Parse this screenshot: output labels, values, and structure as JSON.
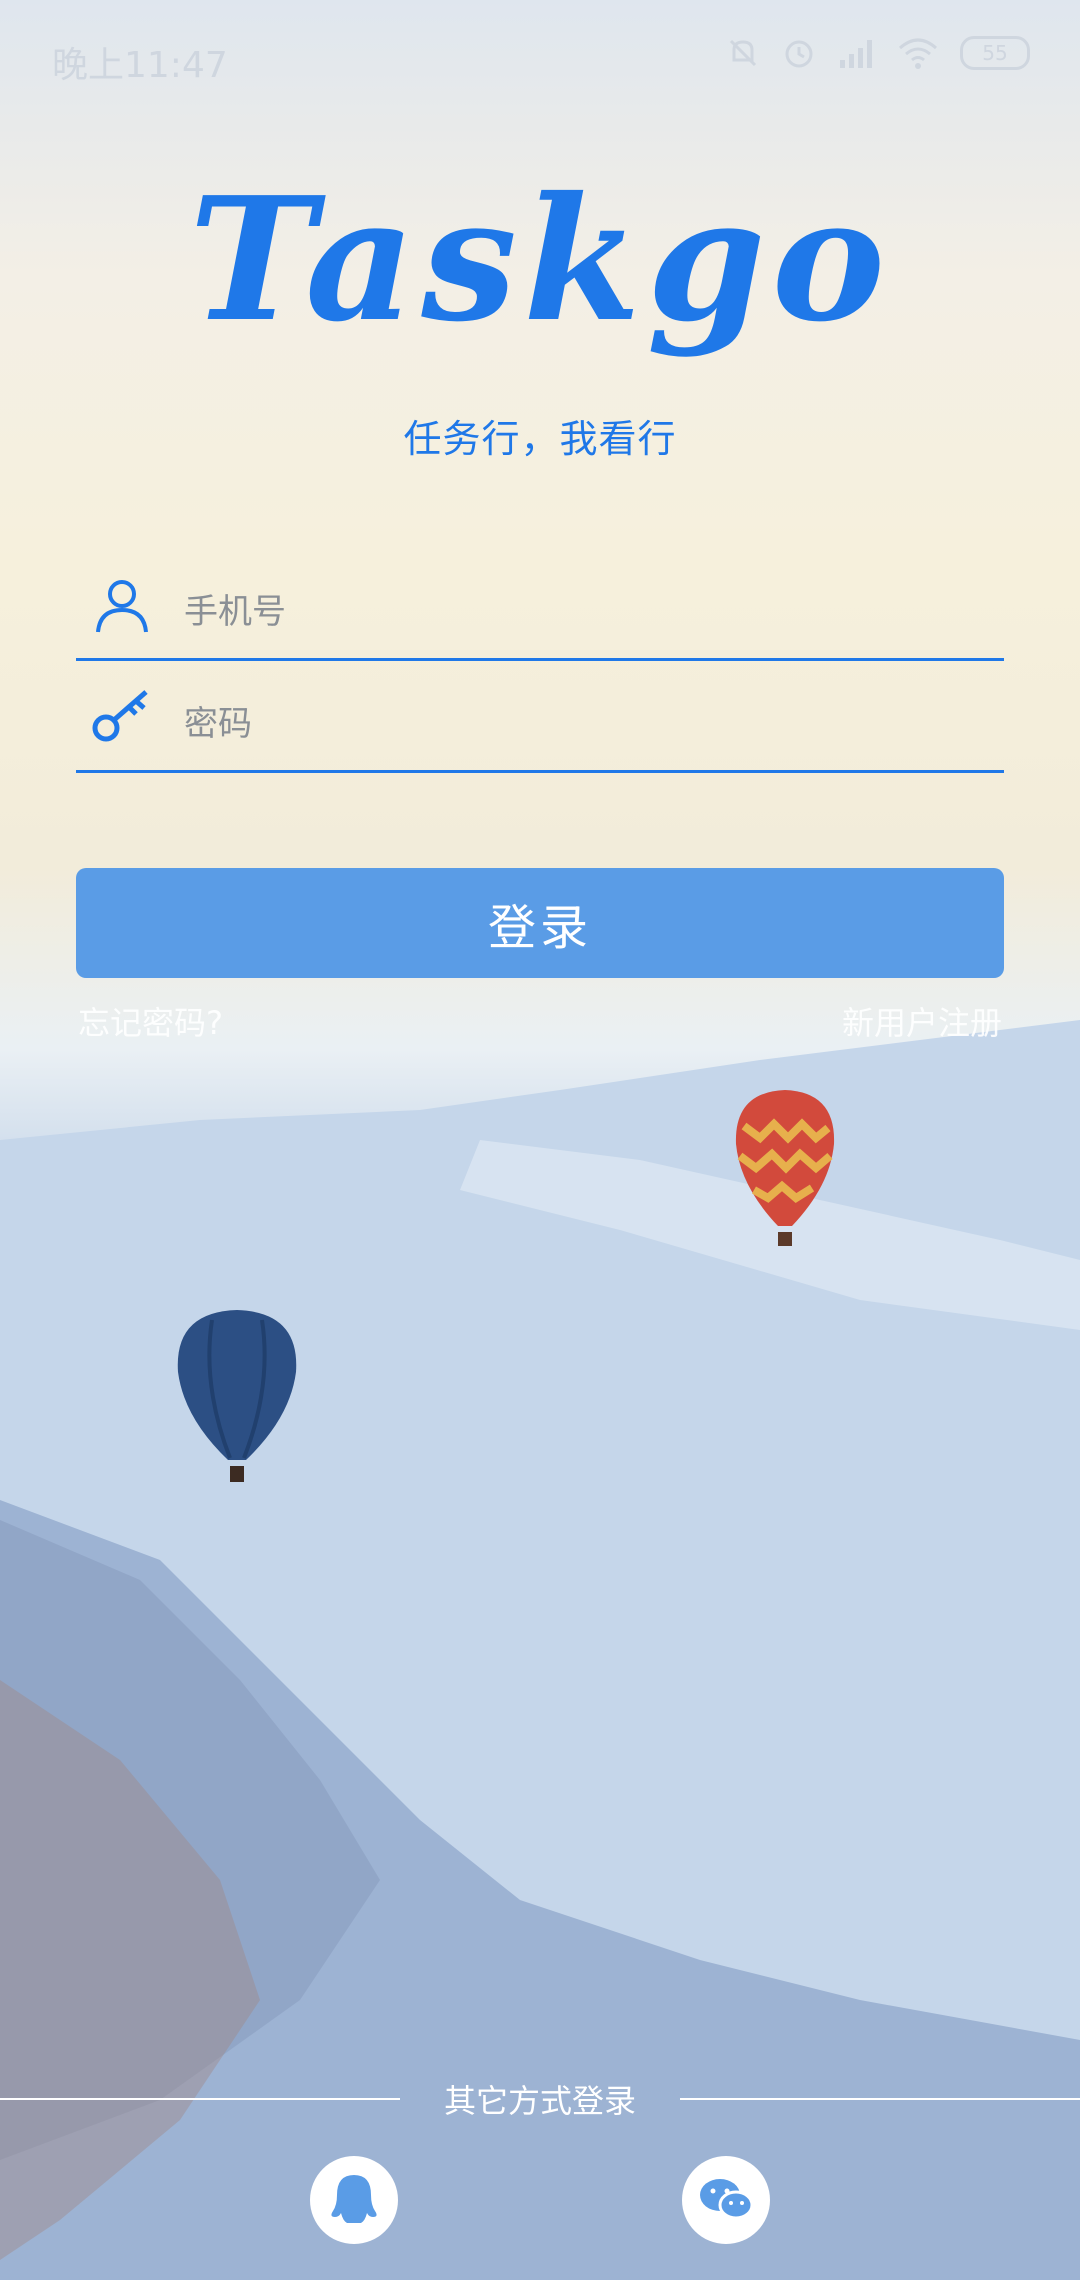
{
  "status_bar": {
    "time": "晚上11:47",
    "battery": "55",
    "icons": [
      "mute-icon",
      "alarm-icon",
      "signal-icon",
      "wifi-icon",
      "battery-icon"
    ]
  },
  "app": {
    "logo": "Taskgo",
    "slogan": "任务行，我看行"
  },
  "form": {
    "phone_placeholder": "手机号",
    "password_placeholder": "密码",
    "login_label": "登录",
    "forgot_label": "忘记密码?",
    "register_label": "新用户注册"
  },
  "other_login": {
    "title": "其它方式登录",
    "options": [
      "qq-icon",
      "wechat-icon"
    ]
  },
  "colors": {
    "accent": "#1f78e8",
    "button": "#5a9ce6"
  }
}
